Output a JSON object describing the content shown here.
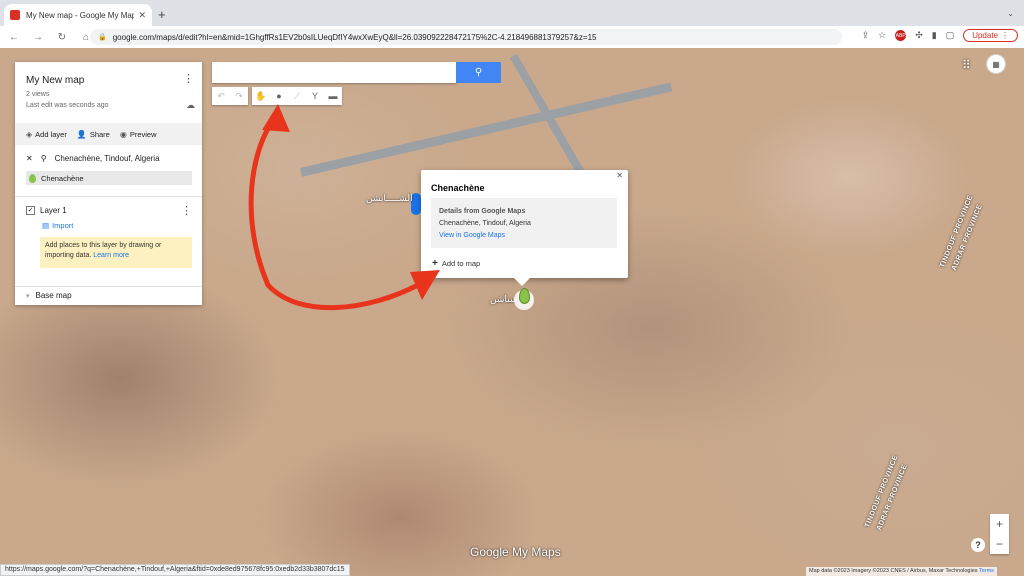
{
  "browser": {
    "tab_title": "My New map - Google My Maps",
    "tab_close": "✕",
    "new_tab": "+",
    "url": "google.com/maps/d/edit?hl=en&mid=1GhgffRs1EV2b0sILUeqDfIY4wxXwEyQ&ll=26.039092228472175%2C-4.218496881379257&z=15",
    "update_label": "Update"
  },
  "panel": {
    "title": "My New map",
    "views": "2 views",
    "last_edit": "Last edit was seconds ago",
    "actions": {
      "add_layer": "Add layer",
      "share": "Share",
      "preview": "Preview"
    },
    "search_query": "Chenachène, Tindouf, Algeria",
    "search_result": "Chenachène",
    "layer_name": "Layer 1",
    "import_label": "Import",
    "hint_text": "Add places to this layer by drawing or importing data.",
    "hint_link": "Learn more",
    "base_map": "Base map"
  },
  "map": {
    "search_placeholder": "",
    "province_1": "TINDOUF PROVINCE",
    "province_2": "ADRAR PROVINCE",
    "province_3": "TINDOUF PROVINCE",
    "province_4": "ADRAR PROVINCE",
    "airport_label_ar": "الشـــــانشن",
    "place_label_ar": "شناشن"
  },
  "infowindow": {
    "title": "Chenachène",
    "details_title": "Details from Google Maps",
    "address": "Chenachène, Tindouf, Algeria",
    "view_link": "View in Google Maps",
    "add_to_map": "Add to map"
  },
  "footer": {
    "brand": "Google My Maps",
    "status_url": "https://maps.google.com/?q=Chenachène,+Tindouf,+Algeria&ftid=0xde8ed975678fc95:0xedb2d33b3807dc15",
    "attribution": "Map data ©2023 Imagery ©2023 CNES / Airbus, Maxar Technologies",
    "terms": "Terms"
  },
  "colors": {
    "accent_blue": "#4285f4",
    "arrow_red": "#e8341c",
    "pin_green": "#8bc34a"
  }
}
